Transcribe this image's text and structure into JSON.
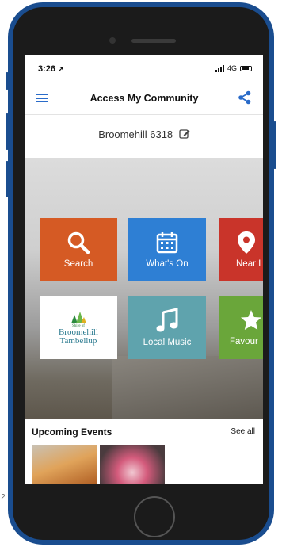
{
  "status_bar": {
    "time": "3:26",
    "network": "4G"
  },
  "nav": {
    "title": "Access My Community"
  },
  "location": {
    "text": "Broomehill 6318"
  },
  "tiles": {
    "search": "Search",
    "whats_on": "What's On",
    "near": "Near I",
    "music": "Local Music",
    "favourites": "Favour"
  },
  "logo": {
    "small": "Shire of",
    "line1": "Broomehill",
    "line2": "Tambellup"
  },
  "events": {
    "title": "Upcoming Events",
    "see_all": "See all"
  },
  "stray_mark": "2",
  "colors": {
    "frame": "#1a4d8f",
    "accent": "#2a6bc9",
    "search": "#d55a24",
    "whats_on": "#2e7fd4",
    "near": "#c9342a",
    "music": "#5fa3ad",
    "favourites": "#6aa63a"
  }
}
